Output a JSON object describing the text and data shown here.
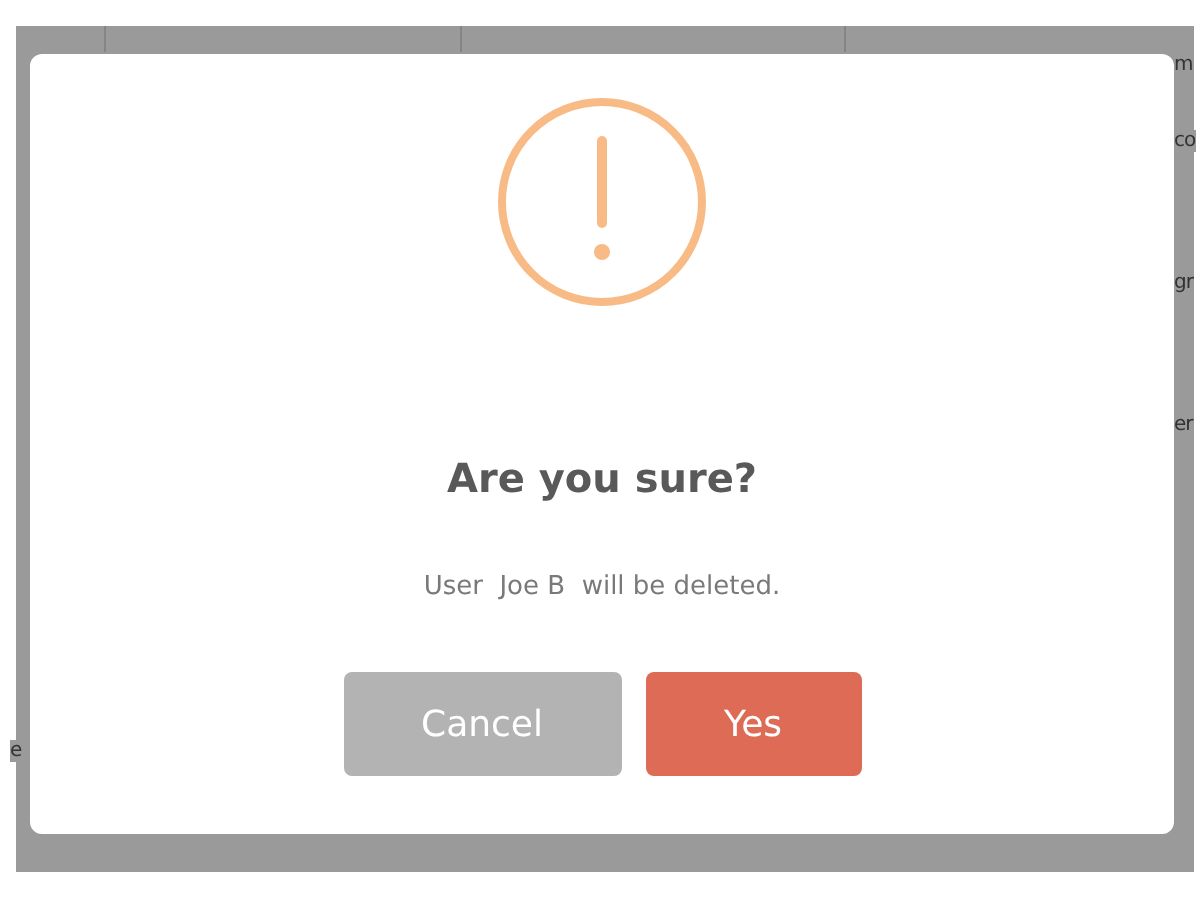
{
  "background": {
    "right_fragments": [
      "m",
      "co",
      "gr",
      "er"
    ],
    "left_fragments": [
      "e"
    ]
  },
  "dialog": {
    "title": "Are you sure?",
    "message": "User  Joe B  will be deleted.",
    "buttons": [
      {
        "label": "Cancel",
        "kind": "cancel"
      },
      {
        "label": "Yes",
        "kind": "confirm"
      }
    ]
  }
}
